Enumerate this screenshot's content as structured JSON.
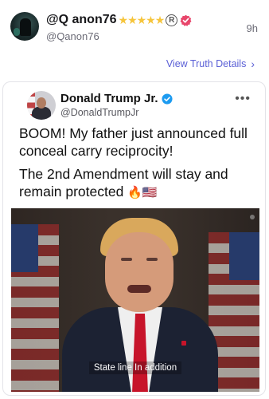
{
  "post": {
    "display_name": "@Q anon76",
    "stars": "★★★★★",
    "registered_mark": "R",
    "handle": "@Qanon76",
    "time": "9h",
    "details_link": "View Truth Details",
    "details_chevron": "›"
  },
  "embedded_tweet": {
    "author_name": "Donald Trump Jr.",
    "author_handle": "@DonaldTrumpJr",
    "more_label": "•••",
    "paragraph_1": "BOOM! My father just announced full conceal carry reciprocity!",
    "paragraph_2": "The 2nd Amendment will stay and remain protected",
    "emoji": "🔥🇺🇸",
    "video_caption": "State line In addition"
  },
  "colors": {
    "link": "#5a5fd6",
    "verified_red": "#e8466b",
    "verified_blue": "#1d9bf0",
    "star": "#f6c53c"
  },
  "icons": {
    "verified_post": "verified-badge-icon",
    "verified_tweet": "verified-check-icon",
    "more": "more-options-icon"
  }
}
